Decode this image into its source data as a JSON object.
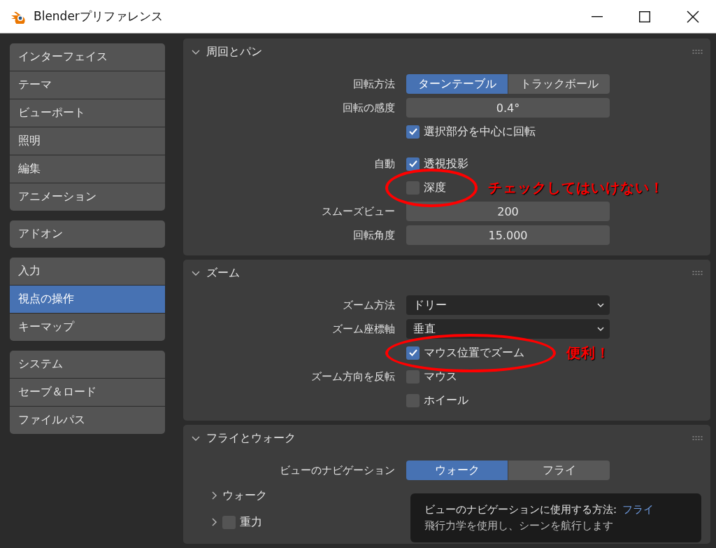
{
  "window": {
    "title": "Blenderプリファレンス"
  },
  "sidebar": {
    "groups": [
      {
        "items": [
          {
            "label": "インターフェイス",
            "selected": false
          },
          {
            "label": "テーマ",
            "selected": false
          },
          {
            "label": "ビューポート",
            "selected": false
          },
          {
            "label": "照明",
            "selected": false
          },
          {
            "label": "編集",
            "selected": false
          },
          {
            "label": "アニメーション",
            "selected": false
          }
        ]
      },
      {
        "items": [
          {
            "label": "アドオン",
            "selected": false
          }
        ]
      },
      {
        "items": [
          {
            "label": "入力",
            "selected": false
          },
          {
            "label": "視点の操作",
            "selected": true
          },
          {
            "label": "キーマップ",
            "selected": false
          }
        ]
      },
      {
        "items": [
          {
            "label": "システム",
            "selected": false
          },
          {
            "label": "セーブ＆ロード",
            "selected": false
          },
          {
            "label": "ファイルパス",
            "selected": false
          }
        ]
      }
    ]
  },
  "panels": [
    {
      "title": "周回とパン",
      "expanded": true,
      "rows": [
        {
          "kind": "segmented",
          "label": "回転方法",
          "options": [
            {
              "label": "ターンテーブル",
              "selected": true
            },
            {
              "label": "トラックボール",
              "selected": false
            }
          ]
        },
        {
          "kind": "number",
          "label": "回転の感度",
          "value": "0.4°"
        },
        {
          "kind": "checkbox",
          "text": "選択部分を中心に回転",
          "checked": true
        },
        {
          "kind": "checkbox",
          "label": "自動",
          "text": "透視投影",
          "checked": true,
          "gap_before": true
        },
        {
          "kind": "checkbox",
          "text": "深度",
          "checked": false,
          "annotation": "チェックしてはいけない！"
        },
        {
          "kind": "number",
          "label": "スムーズビュー",
          "value": "200"
        },
        {
          "kind": "number",
          "label": "回転角度",
          "value": "15.000"
        }
      ]
    },
    {
      "title": "ズーム",
      "expanded": true,
      "rows": [
        {
          "kind": "dropdown",
          "label": "ズーム方法",
          "value": "ドリー"
        },
        {
          "kind": "dropdown",
          "label": "ズーム座標軸",
          "value": "垂直"
        },
        {
          "kind": "checkbox",
          "text": "マウス位置でズーム",
          "checked": true,
          "annotation": "便利！"
        },
        {
          "kind": "checkbox",
          "label": "ズーム方向を反転",
          "text": "マウス",
          "checked": false
        },
        {
          "kind": "checkbox",
          "text": "ホイール",
          "checked": false
        }
      ]
    },
    {
      "title": "フライとウォーク",
      "expanded": true,
      "rows": [
        {
          "kind": "segmented",
          "label": "ビューのナビゲーション",
          "options": [
            {
              "label": "ウォーク",
              "selected": true
            },
            {
              "label": "フライ",
              "selected": false
            }
          ]
        }
      ],
      "subpanels": [
        {
          "title": "ウォーク",
          "expanded": false
        },
        {
          "title": "重力",
          "expanded": false,
          "checked": false
        }
      ],
      "tooltip": {
        "title": "ビューのナビゲーションに使用する方法:",
        "value": "フライ",
        "description": "飛行力学を使用し、シーンを航行します"
      }
    }
  ]
}
